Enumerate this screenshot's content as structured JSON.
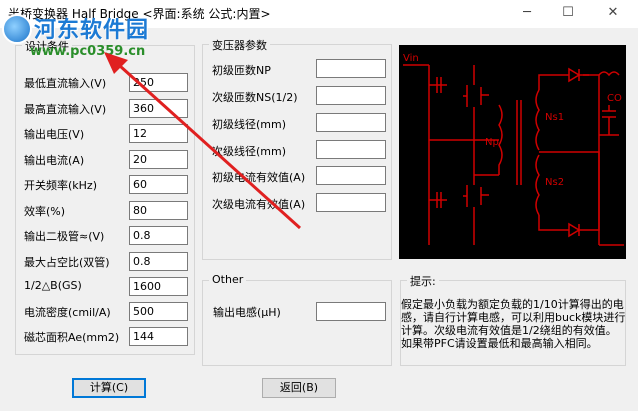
{
  "window": {
    "title": "半桥变换器 Half Bridge  <界面:系统  公式:内置>",
    "min_glyph": "─",
    "max_glyph": "☐",
    "close_glyph": "✕"
  },
  "watermark": {
    "site_name": "河东软件园",
    "url": "www.pc0359.cn"
  },
  "design": {
    "group_label": "设计条件",
    "rows": [
      {
        "label": "最低直流输入(V)",
        "value": "250"
      },
      {
        "label": "最高直流输入(V)",
        "value": "360"
      },
      {
        "label": "输出电压(V)",
        "value": "12"
      },
      {
        "label": "输出电流(A)",
        "value": "20"
      },
      {
        "label": "开关频率(kHz)",
        "value": "60"
      },
      {
        "label": "效率(%)",
        "value": "80"
      },
      {
        "label": "输出二极管≈(V)",
        "value": "0.8"
      },
      {
        "label": "最大占空比(双管)",
        "value": "0.8"
      },
      {
        "label": "1/2△B(GS)",
        "value": "1600"
      },
      {
        "label": "电流密度(cmil/A)",
        "value": "500"
      },
      {
        "label": "磁芯面积Ae(mm2)",
        "value": "144"
      }
    ]
  },
  "transformer": {
    "group_label": "变压器参数",
    "rows": [
      {
        "label": "初级匝数NP",
        "value": ""
      },
      {
        "label": "次级匝数NS(1/2)",
        "value": ""
      },
      {
        "label": "初级线径(mm)",
        "value": ""
      },
      {
        "label": "次级线径(mm)",
        "value": ""
      },
      {
        "label": "初级电流有效值(A)",
        "value": ""
      },
      {
        "label": "次级电流有效值(A)",
        "value": ""
      }
    ]
  },
  "other": {
    "group_label": "Other",
    "inductance_label": "输出电感(μH)",
    "inductance_value": ""
  },
  "hint": {
    "label": "提示:",
    "text": "假定最小负载为额定负载的1/10计算得出的电感，请自行计算电感，可以利用buck模块进行计算。次级电流有效值是1/2绕组的有效值。如果带PFC请设置最低和最高输入相同。"
  },
  "schematic": {
    "vin_label": "Vin",
    "np_label": "Np",
    "ns1_label": "Ns1",
    "ns2_label": "Ns2",
    "co_label": "CO"
  },
  "buttons": {
    "calculate": "计算(C)",
    "back": "返回(B)"
  }
}
